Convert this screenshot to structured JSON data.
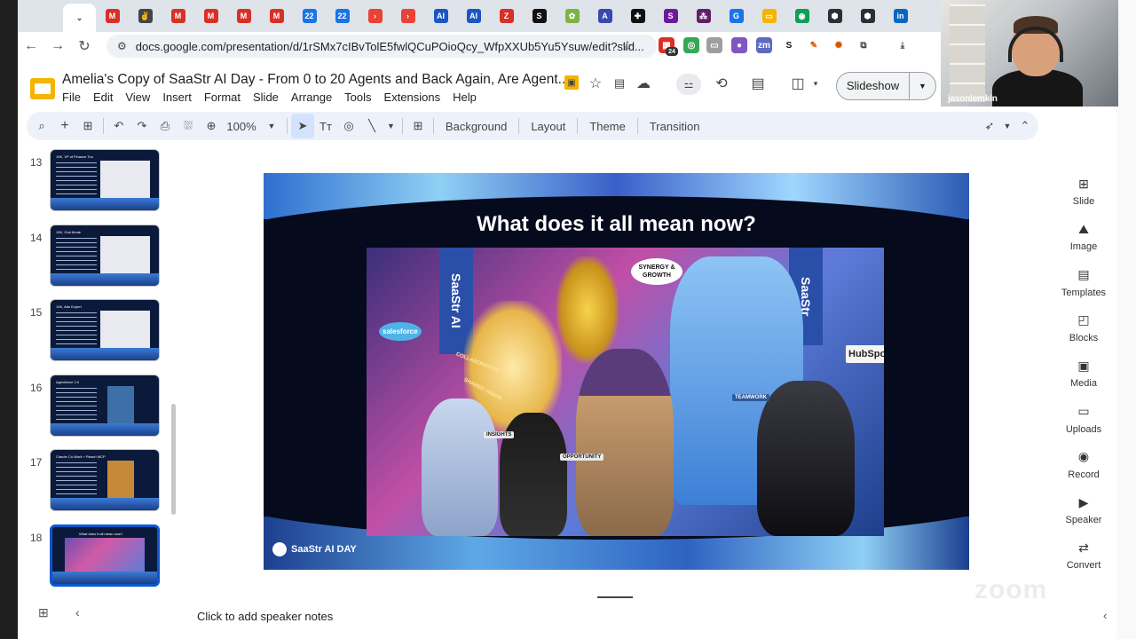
{
  "browser": {
    "url": "docs.google.com/presentation/d/1rSMx7cIBvTolE5fwlQCuPOioQcy_WfpXXUb5Yu5Ysuw/edit?slid...",
    "tabs": [
      {
        "icon": "window-icon",
        "color": "#5f6368",
        "letter": ""
      },
      {
        "icon": "chevron-down-icon",
        "color": "#444",
        "letter": "⌄"
      },
      {
        "icon": "gmail-icon",
        "color": "#d93025",
        "letter": "M"
      },
      {
        "icon": "peace-icon",
        "color": "#444",
        "letter": "✌"
      },
      {
        "icon": "gmail-icon",
        "color": "#d93025",
        "letter": "M"
      },
      {
        "icon": "gmail-icon",
        "color": "#d93025",
        "letter": "M"
      },
      {
        "icon": "gmail-icon",
        "color": "#d93025",
        "letter": "M"
      },
      {
        "icon": "gmail-icon",
        "color": "#d93025",
        "letter": "M"
      },
      {
        "icon": "calendar-icon",
        "color": "#1a73e8",
        "letter": "22"
      },
      {
        "icon": "calendar-icon",
        "color": "#1a73e8",
        "letter": "22"
      },
      {
        "icon": "arrow-icon",
        "color": "#ea4335",
        "letter": "›"
      },
      {
        "icon": "arrow-icon",
        "color": "#ea4335",
        "letter": "›"
      },
      {
        "icon": "ai-icon",
        "color": "#1a56c4",
        "letter": "AI"
      },
      {
        "icon": "ai-icon",
        "color": "#1a56c4",
        "letter": "AI"
      },
      {
        "icon": "z-icon",
        "color": "#d93025",
        "letter": "Z"
      },
      {
        "icon": "s-icon",
        "color": "#111",
        "letter": "S"
      },
      {
        "icon": "leaf-icon",
        "color": "#7cb342",
        "letter": "✿"
      },
      {
        "icon": "triangle-icon",
        "color": "#3949ab",
        "letter": "A"
      },
      {
        "icon": "grid-icon",
        "color": "#111",
        "letter": "✚"
      },
      {
        "icon": "s-icon",
        "color": "#6a1b9a",
        "letter": "S"
      },
      {
        "icon": "slack-icon",
        "color": "#611f69",
        "letter": "⁂"
      },
      {
        "icon": "g-icon",
        "color": "#1a73e8",
        "letter": "G"
      },
      {
        "icon": "folder-icon",
        "color": "#f4b400",
        "letter": "▭"
      },
      {
        "icon": "person-icon",
        "color": "#0f9d58",
        "letter": "◉"
      },
      {
        "icon": "hex-icon",
        "color": "#263238",
        "letter": "⬢"
      },
      {
        "icon": "hex-icon",
        "color": "#263238",
        "letter": "⬢"
      },
      {
        "icon": "linkedin-icon",
        "color": "#0a66c2",
        "letter": "in"
      }
    ],
    "extension_badge": "24"
  },
  "doc": {
    "title": "Amelia's Copy of SaaStr AI Day - From 0 to 20 Agents and Back Again, Are Agent...",
    "menus": [
      "File",
      "Edit",
      "View",
      "Insert",
      "Format",
      "Slide",
      "Arrange",
      "Tools",
      "Extensions",
      "Help"
    ],
    "slideshow_label": "Slideshow"
  },
  "toolbar": {
    "zoom": "100%",
    "text_buttons": [
      "Background",
      "Layout",
      "Theme",
      "Transition"
    ]
  },
  "filmstrip": {
    "slides": [
      {
        "num": "13",
        "title": "10K, VP of Finance Too"
      },
      {
        "num": "14",
        "title": "10K, God Mode"
      },
      {
        "num": "15",
        "title": "10K, Ads Expert"
      },
      {
        "num": "16",
        "title": "Agentforce 2.0"
      },
      {
        "num": "17",
        "title": "Claude Co-Work + Reach MCP"
      },
      {
        "num": "18",
        "title": "What does it all mean now?"
      }
    ],
    "selected": "18"
  },
  "slide": {
    "title": "What does it all mean now?",
    "logo_text": "SaaStr AI DAY",
    "illustration": {
      "banner_left": "SaaStr AI",
      "banner_right": "SaaStr",
      "bubble": "SYNERGY & GROWTH",
      "tags": [
        "COLLABORATION",
        "SHARED VISION",
        "INSIGHTS",
        "OPPORTUNITY",
        "TEAMWORK",
        "salesforce",
        "HubSpot"
      ]
    }
  },
  "notes": {
    "placeholder": "Click to add speaker notes"
  },
  "side_panel": [
    {
      "icon": "add-slide-icon",
      "label": "Slide"
    },
    {
      "icon": "image-icon",
      "label": "Image"
    },
    {
      "icon": "templates-icon",
      "label": "Templates"
    },
    {
      "icon": "blocks-icon",
      "label": "Blocks"
    },
    {
      "icon": "media-icon",
      "label": "Media"
    },
    {
      "icon": "folder-icon",
      "label": "Uploads"
    },
    {
      "icon": "record-icon",
      "label": "Record"
    },
    {
      "icon": "speaker-icon",
      "label": "Speaker"
    },
    {
      "icon": "convert-icon",
      "label": "Convert"
    }
  ],
  "webcam": {
    "name": "jasonlemkin"
  },
  "watermark": "zoom"
}
